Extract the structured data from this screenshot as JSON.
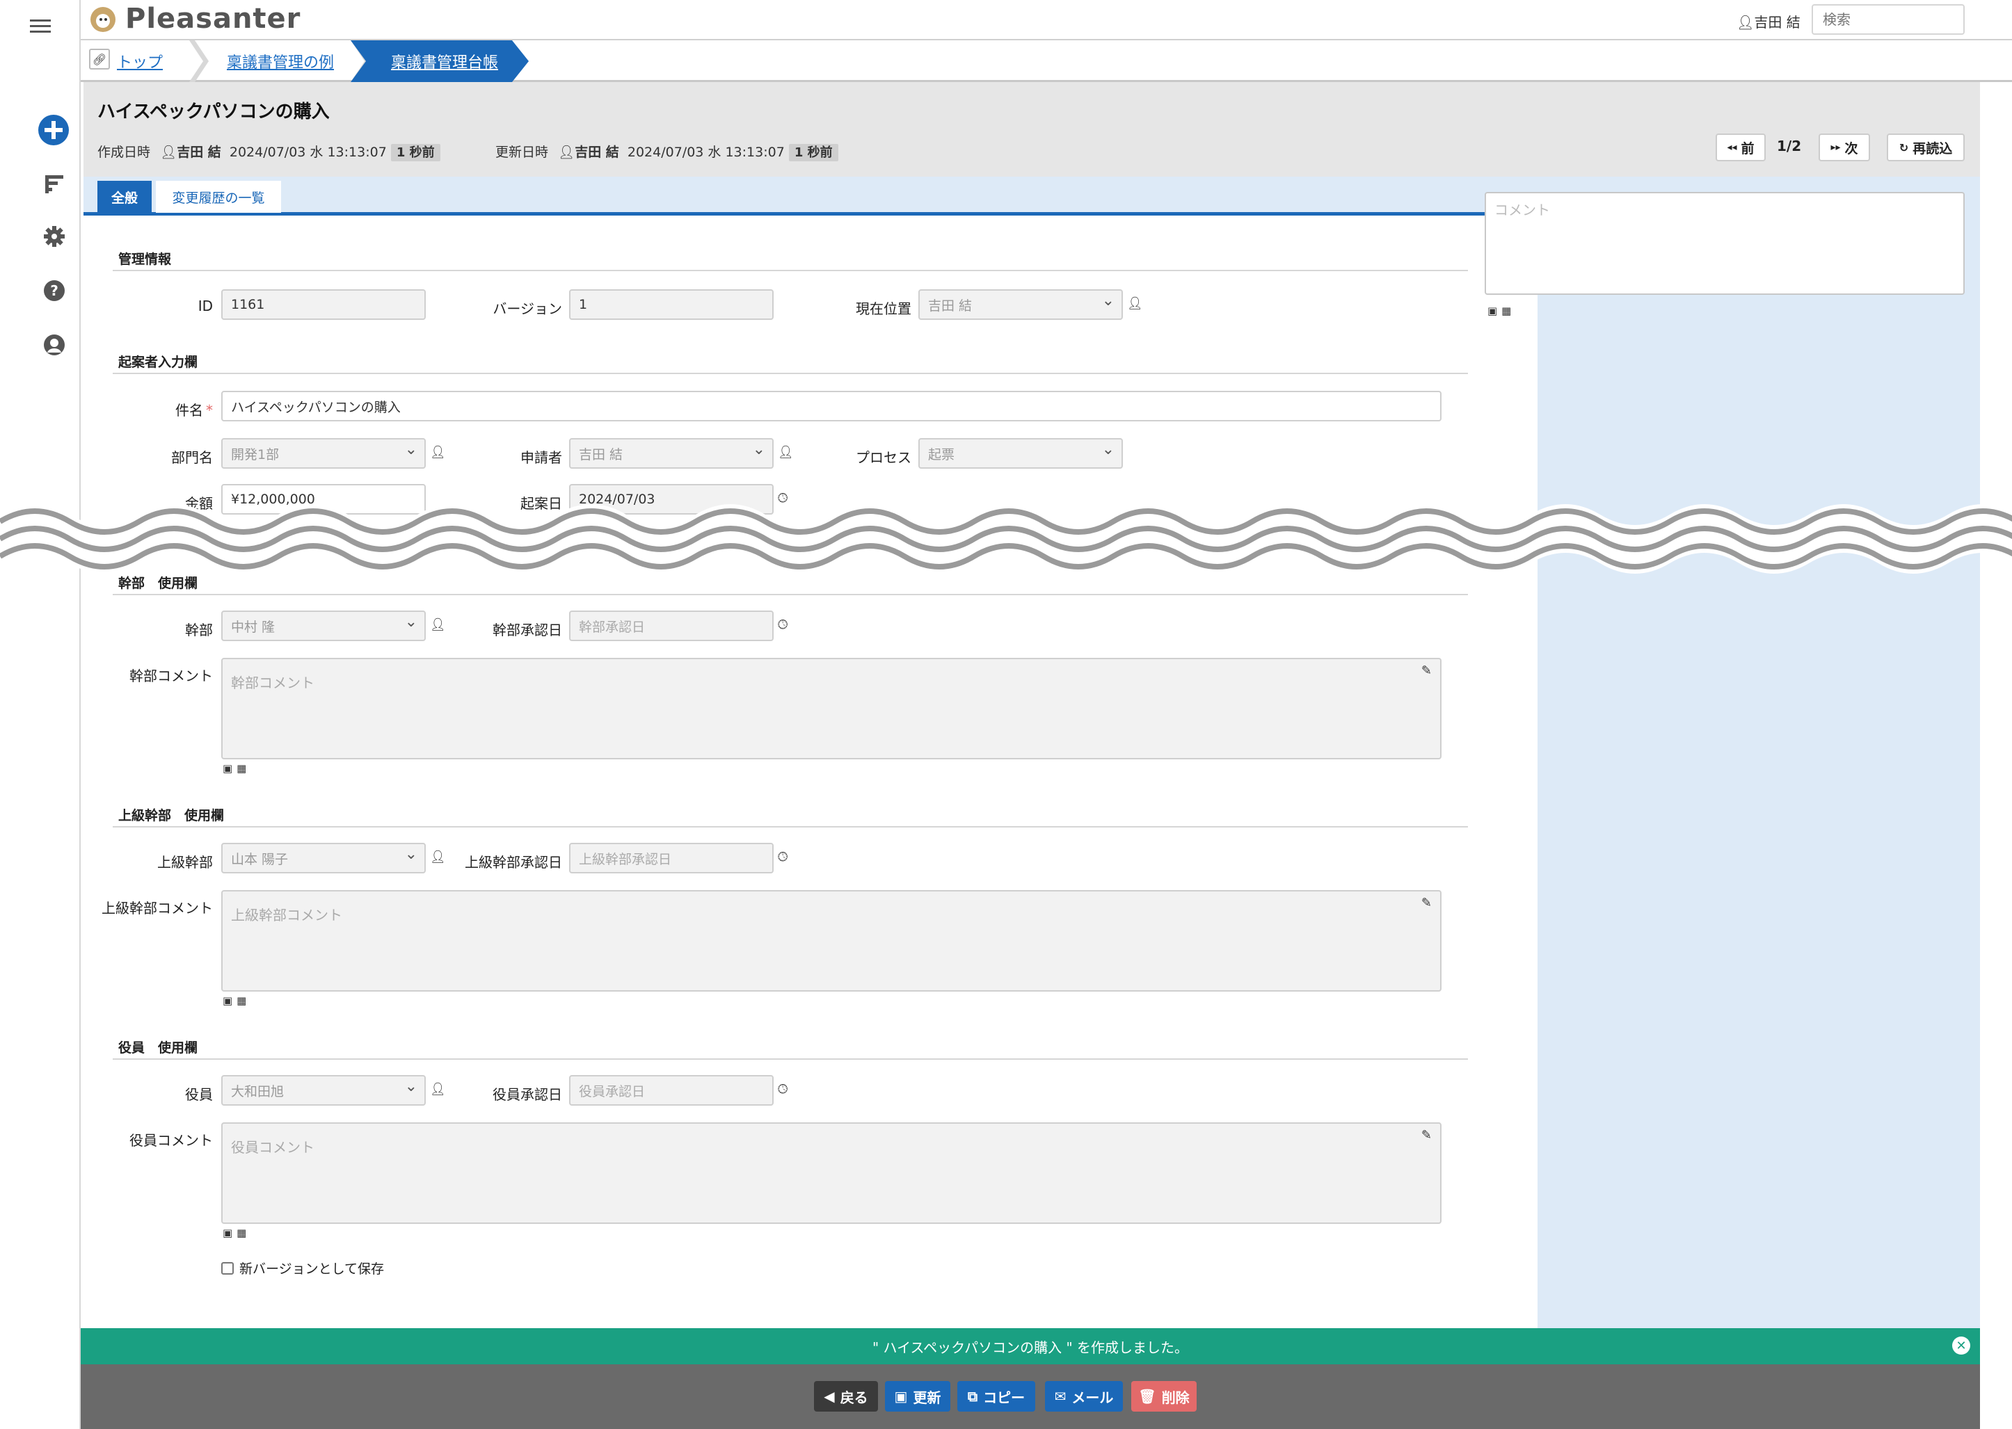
{
  "header": {
    "logo": "Pleasanter",
    "user": "吉田 結",
    "search_placeholder": "検索"
  },
  "rail": {
    "icons": [
      "hamburger-icon",
      "plus-icon",
      "sort-icon",
      "gear-icon",
      "help-icon",
      "user-icon"
    ]
  },
  "breadcrumb": [
    "トップ",
    "稟議書管理の例",
    "稟議書管理台帳"
  ],
  "record": {
    "title": "ハイスペックパソコンの購入",
    "created_label": "作成日時",
    "created_user": "吉田 結",
    "created_at": "2024/07/03 水 13:13:07",
    "created_ago": "1 秒前",
    "updated_label": "更新日時",
    "updated_user": "吉田 結",
    "updated_at": "2024/07/03 水 13:13:07",
    "updated_ago": "1 秒前"
  },
  "nav": {
    "prev": "前",
    "position": "1/2",
    "next": "次",
    "reload": "再読込"
  },
  "tabs": [
    "全般",
    "変更履歴の一覧"
  ],
  "sections": {
    "management": "管理情報",
    "applicant": "起案者入力欄",
    "manager": "幹部　使用欄",
    "senior": "上級幹部　使用欄",
    "officer": "役員　使用欄"
  },
  "fields": {
    "id_label": "ID",
    "id_value": "1161",
    "version_label": "バージョン",
    "version_value": "1",
    "location_label": "現在位置",
    "location_value": "吉田 結",
    "subject_label": "件名",
    "required_mark": "*",
    "subject_value": "ハイスペックパソコンの購入",
    "dept_label": "部門名",
    "dept_value": "開発1部",
    "applicant_label": "申請者",
    "applicant_value": "吉田 結",
    "process_label": "プロセス",
    "process_value": "起票",
    "amount_label": "金額",
    "amount_value": "¥12,000,000",
    "date_label": "起案日",
    "date_value": "2024/07/03",
    "manager_label": "幹部",
    "manager_value": "中村 隆",
    "manager_date_label": "幹部承認日",
    "manager_date_placeholder": "幹部承認日",
    "manager_comment_label": "幹部コメント",
    "manager_comment_placeholder": "幹部コメント",
    "senior_label": "上級幹部",
    "senior_value": "山本 陽子",
    "senior_date_label": "上級幹部承認日",
    "senior_date_placeholder": "上級幹部承認日",
    "senior_comment_label": "上級幹部コメント",
    "senior_comment_placeholder": "上級幹部コメント",
    "officer_label": "役員",
    "officer_value": "大和田旭",
    "officer_date_label": "役員承認日",
    "officer_date_placeholder": "役員承認日",
    "officer_comment_label": "役員コメント",
    "officer_comment_placeholder": "役員コメント",
    "new_version_label": "新バージョンとして保存"
  },
  "comment": {
    "placeholder": "コメント"
  },
  "message": "\" ハイスペックパソコンの購入 \" を作成しました。",
  "toolbar": {
    "back": "戻る",
    "update": "更新",
    "copy": "コピー",
    "mail": "メール",
    "delete": "削除"
  },
  "colors": {
    "accent": "#1b68b8",
    "success": "#1aa082",
    "toolbar_bg": "#6a6a6a",
    "back_btn": "#3a3a3a",
    "primary_btn": "#1b68b8",
    "delete_btn": "#e36a6a",
    "panel_bg": "#ddeaf7"
  }
}
